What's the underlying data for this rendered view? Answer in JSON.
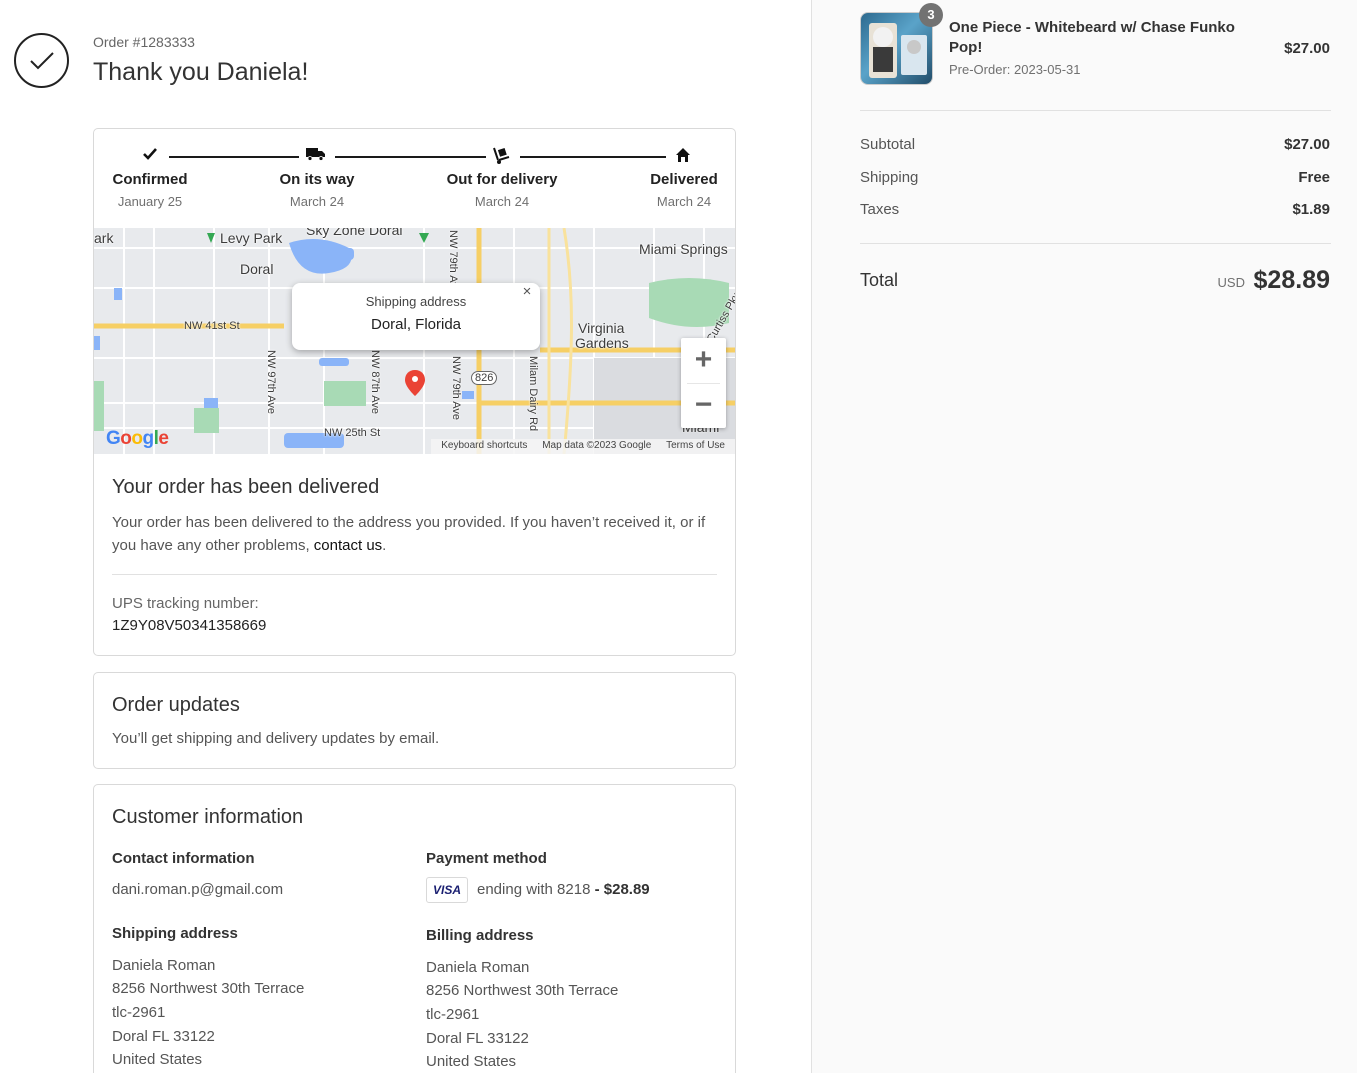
{
  "header": {
    "order_number": "Order #1283333",
    "thank_you": "Thank you Daniela!"
  },
  "status": {
    "steps": [
      {
        "label": "Confirmed",
        "date": "January 25",
        "icon": "check-icon"
      },
      {
        "label": "On its way",
        "date": "March 24",
        "icon": "truck-icon"
      },
      {
        "label": "Out for delivery",
        "date": "March 24",
        "icon": "hand-truck-icon"
      },
      {
        "label": "Delivered",
        "date": "March 24",
        "icon": "home-icon"
      }
    ],
    "map": {
      "popup_title": "Shipping address",
      "popup_city": "Doral, Florida",
      "labels": {
        "ark": "ark",
        "levy_park": "Levy Park",
        "sky_zone": "Sky Zone Doral",
        "doral": "Doral",
        "miami_springs": "Miami Springs",
        "nw41": "NW 41st St",
        "virginia": "Virginia",
        "gardens": "Gardens",
        "nw25": "NW 25th St",
        "nw97": "NW 97th Ave",
        "nw87": "NW 87th Ave",
        "nw79": "NW 79th Ave",
        "nw79b": "NW 79th Ave",
        "milam": "Milam Dairy Rd",
        "curtiss": "Curtiss Pkwy",
        "miami": "Miami",
        "route": "826"
      },
      "footer_keyboard": "Keyboard shortcuts",
      "footer_data": "Map data ©2023 Google",
      "footer_terms": "Terms of Use",
      "zoom_in": "+",
      "zoom_out": "−",
      "close": "×",
      "logo": "Google"
    },
    "delivered_title": "Your order has been delivered",
    "delivered_text": "Your order has been delivered to the address you provided. If you haven’t received it, or if you have any other problems, ",
    "contact_link": "contact us",
    "delivered_end": ".",
    "tracking_label": "UPS tracking number:",
    "tracking_number": "1Z9Y08V50341358669"
  },
  "updates": {
    "title": "Order updates",
    "text": "You’ll get shipping and delivery updates by email."
  },
  "customer": {
    "title": "Customer information",
    "contact_heading": "Contact information",
    "email": "dani.roman.p@gmail.com",
    "payment_heading": "Payment method",
    "card_brand": "VISA",
    "payment_text": "ending with 8218",
    "payment_amount": " - $28.89",
    "shipping_heading": "Shipping address",
    "shipping_lines": [
      "Daniela Roman",
      "8256 Northwest 30th Terrace",
      "tlc-2961",
      "Doral FL 33122",
      "United States"
    ],
    "billing_heading": "Billing address",
    "billing_lines": [
      "Daniela Roman",
      "8256 Northwest 30th Terrace",
      "tlc-2961",
      "Doral FL 33122",
      "United States"
    ]
  },
  "summary": {
    "product": {
      "quantity": "3",
      "name": "One Piece - Whitebeard w/ Chase Funko Pop!",
      "variant": "Pre-Order: 2023-05-31",
      "price": "$27.00"
    },
    "subtotal_label": "Subtotal",
    "subtotal": "$27.00",
    "shipping_label": "Shipping",
    "shipping": "Free",
    "taxes_label": "Taxes",
    "taxes": "$1.89",
    "total_label": "Total",
    "currency": "USD",
    "total": "$28.89"
  }
}
